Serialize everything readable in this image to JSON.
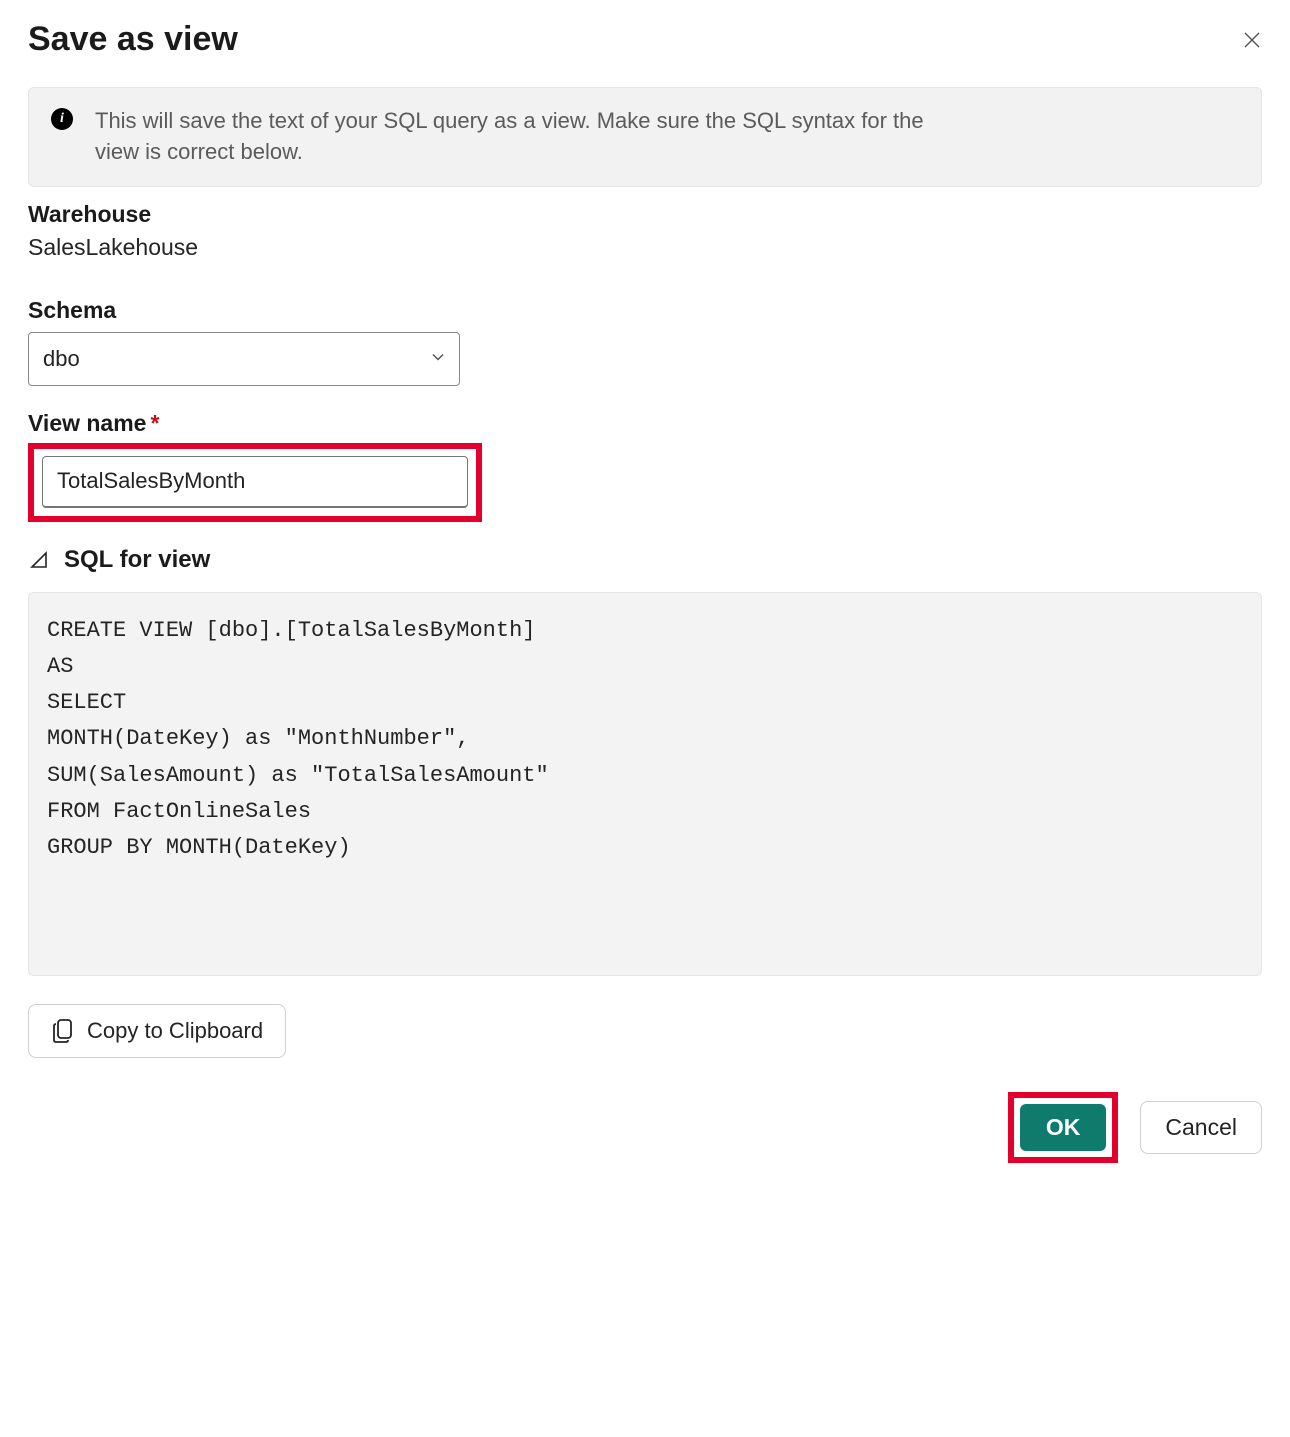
{
  "dialog": {
    "title": "Save as view",
    "info_text": "This will save the text of your SQL query as a view. Make sure the SQL syntax for the view is correct below."
  },
  "warehouse": {
    "label": "Warehouse",
    "value": "SalesLakehouse"
  },
  "schema": {
    "label": "Schema",
    "selected": "dbo"
  },
  "view_name": {
    "label": "View name",
    "required_mark": "*",
    "value": "TotalSalesByMonth"
  },
  "sql": {
    "heading": "SQL for view",
    "code": "CREATE VIEW [dbo].[TotalSalesByMonth]\nAS\nSELECT\nMONTH(DateKey) as \"MonthNumber\",\nSUM(SalesAmount) as \"TotalSalesAmount\"\nFROM FactOnlineSales\nGROUP BY MONTH(DateKey)"
  },
  "buttons": {
    "copy": "Copy to Clipboard",
    "ok": "OK",
    "cancel": "Cancel"
  }
}
